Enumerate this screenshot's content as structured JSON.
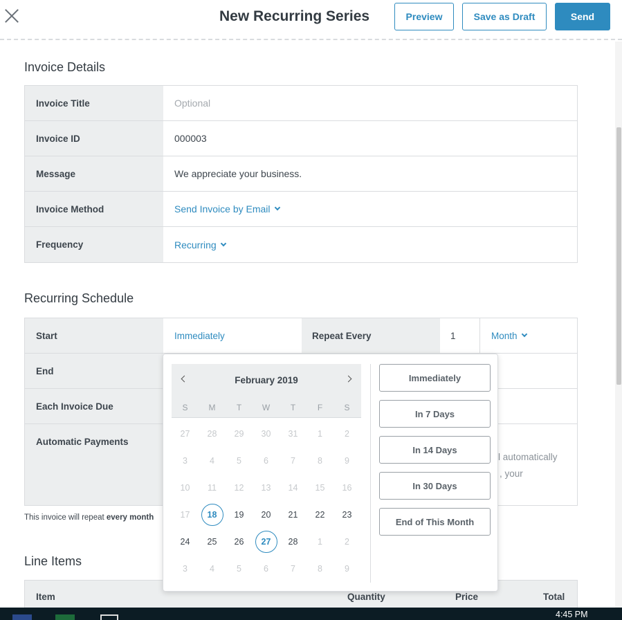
{
  "header": {
    "title": "New Recurring Series",
    "preview_label": "Preview",
    "draft_label": "Save as Draft",
    "send_label": "Send"
  },
  "invoice_details": {
    "title": "Invoice Details",
    "rows": [
      {
        "label": "Invoice Title",
        "value": "",
        "placeholder": "Optional"
      },
      {
        "label": "Invoice ID",
        "value": "000003"
      },
      {
        "label": "Message",
        "value": "We appreciate your business."
      },
      {
        "label": "Invoice Method",
        "value": "Send Invoice by Email"
      },
      {
        "label": "Frequency",
        "value": "Recurring"
      }
    ]
  },
  "recurring": {
    "title": "Recurring Schedule",
    "start_label": "Start",
    "start_value": "Immediately",
    "repeat_label": "Repeat Every",
    "repeat_count": "1",
    "repeat_unit": "Month",
    "end_label": "End",
    "due_label": "Each Invoice Due",
    "autopay_label": "Automatic Payments",
    "autopay_text_1": "l automatically",
    "autopay_text_2": ", your",
    "note_prefix": "This invoice will repeat ",
    "note_bold": "every month"
  },
  "line_items": {
    "title": "Line Items",
    "col_item": "Item",
    "col_quantity": "Quantity",
    "col_price": "Price",
    "col_total": "Total"
  },
  "calendar": {
    "month": "February 2019",
    "dow": [
      "S",
      "M",
      "T",
      "W",
      "T",
      "F",
      "S"
    ],
    "weeks": [
      [
        "27",
        "28",
        "29",
        "30",
        "31",
        "1",
        "2"
      ],
      [
        "3",
        "4",
        "5",
        "6",
        "7",
        "8",
        "9"
      ],
      [
        "10",
        "11",
        "12",
        "13",
        "14",
        "15",
        "16"
      ],
      [
        "17",
        "18",
        "19",
        "20",
        "21",
        "22",
        "23"
      ],
      [
        "24",
        "25",
        "26",
        "27",
        "28",
        "1",
        "2"
      ],
      [
        "3",
        "4",
        "5",
        "6",
        "7",
        "8",
        "9"
      ]
    ],
    "today": "18",
    "selected": "27"
  },
  "quick_options": [
    "Immediately",
    "In 7 Days",
    "In 14 Days",
    "In 30 Days",
    "End of This Month"
  ],
  "taskbar": {
    "time": "4:45 PM"
  },
  "colors": {
    "accent": "#2e8bbf",
    "label_bg": "#eceeef",
    "border": "#dadcdf"
  }
}
